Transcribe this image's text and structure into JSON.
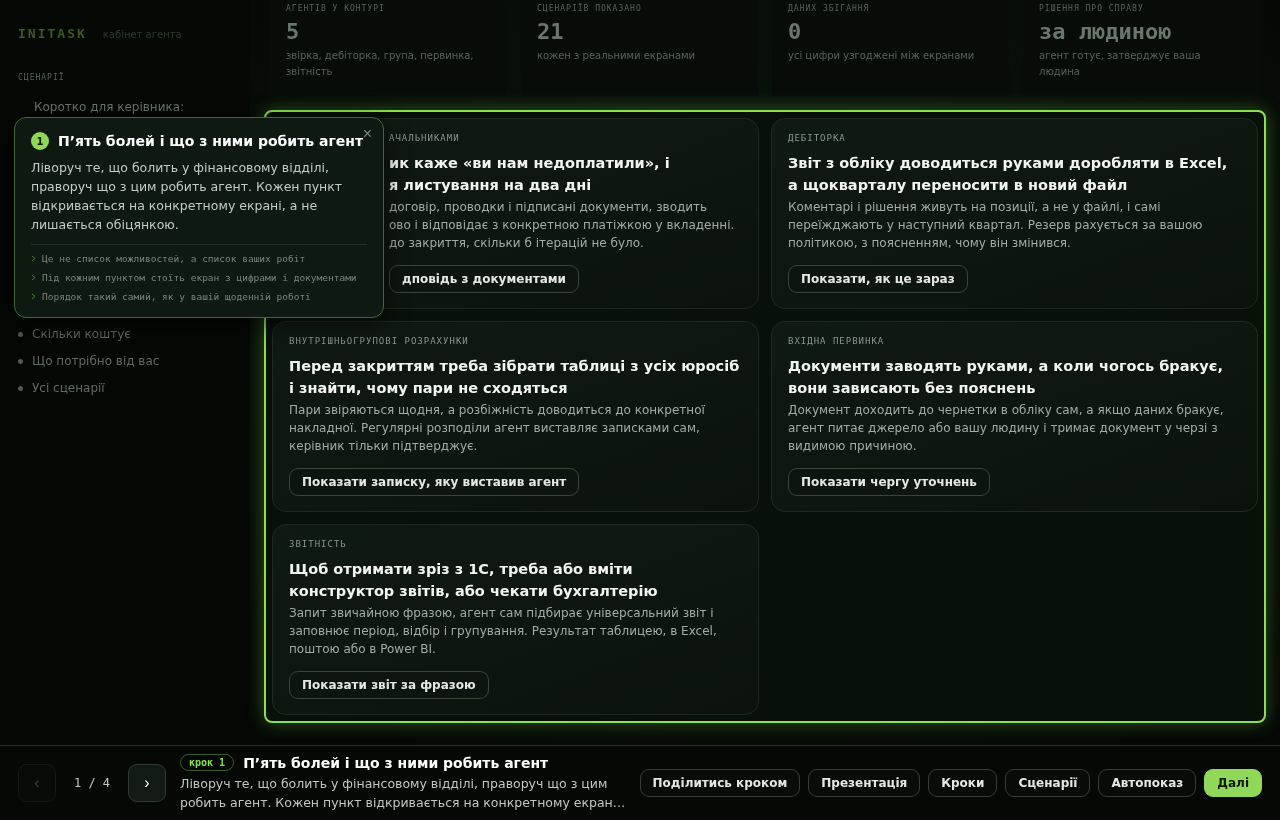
{
  "sidebar": {
    "brand": "INITASK",
    "subtitle": "кабінет агента",
    "section": "СЦЕНАРІЇ",
    "items": [
      {
        "label": "Коротко для керівника:",
        "bullet": false
      },
      {
        "label": "Скільки коштує",
        "bullet": true
      },
      {
        "label": "Що потрібно від вас",
        "bullet": true
      },
      {
        "label": "Усі сценарії",
        "bullet": true
      }
    ]
  },
  "stats": [
    {
      "label": "АГЕНТІВ У КОНТУРІ",
      "value": "5",
      "note": "звірка, дебіторка, група, первинка, звітність"
    },
    {
      "label": "СЦЕНАРІЇВ ПОКАЗАНО",
      "value": "21",
      "note": "кожен з реальними екранами"
    },
    {
      "label": "ДАНИХ ЗБІГАННЯ",
      "value": "0",
      "note": "усі цифри узгоджені між екранами"
    },
    {
      "label": "РІШЕННЯ ПРО СПРАВУ",
      "value": "за людиною",
      "note": "агент готує, затверджує ваша людина"
    }
  ],
  "cards": [
    {
      "tag": "АЧАЛЬНИКАМИ",
      "title": "ик каже «ви нам недоплатили», і\nя листування на два дні",
      "text": "договір, проводки і підписані документи, зводить\nово і відповідає з конкретною платіжкою у вкладенні.\nдо закриття, скільки б ітерацій не було.",
      "button": "дповідь з документами",
      "covered": true
    },
    {
      "tag": "ДЕБІТОРКА",
      "title": "Звіт з обліку доводиться руками доробляти в Excel, а щокварталу переносити в новий файл",
      "text": "Коментарі і рішення живуть на позиції, а не у файлі, і самі переїжджають у наступний квартал. Резерв рахується за вашою політикою, з поясненням, чому він змінився.",
      "button": "Показати, як це зараз",
      "covered": false
    },
    {
      "tag": "ВНУТРІШНЬОГРУПОВІ РОЗРАХУНКИ",
      "title": "Перед закриттям треба зібрати таблиці з усіх юросіб і знайти, чому пари не сходяться",
      "text": "Пари звіряються щодня, а розбіжність доводиться до конкретної накладної. Регулярні розподіли агент виставляє записками сам, керівник тільки підтверджує.",
      "button": "Показати записку, яку виставив агент",
      "covered": false
    },
    {
      "tag": "ВХІДНА ПЕРВИНКА",
      "title": "Документи заводять руками, а коли чогось бракує, вони зависають без пояснень",
      "text": "Документ доходить до чернетки в обліку сам, а якщо даних бракує, агент питає джерело або вашу людину і тримає документ у черзі з видимою причиною.",
      "button": "Показати чергу уточнень",
      "covered": false
    },
    {
      "tag": "ЗВІТНІСТЬ",
      "title": "Щоб отримати зріз з 1С, треба або вміти конструктор звітів, або чекати бухгалтерію",
      "text": "Запит звичайною фразою, агент сам підбирає універсальний звіт і заповнює період, відбір і групування. Результат таблицею, в Excel, поштою або в Power BI.",
      "button": "Показати звіт за фразою",
      "covered": false
    }
  ],
  "popover": {
    "number": "1",
    "title": "П’ять болей і що з ними робить агент",
    "close": "×",
    "text": "Ліворуч те, що болить у фінансовому відділі, праворуч що з цим робить агент. Кожен пункт відкривається на конкретному екрані, а не лишається обіцянкою.",
    "bullets": [
      "Це не список можливостей, а список ваших робіт",
      "Під кожним пунктом стоїть екран з цифрами і документами",
      "Порядок такий самий, як у вашій щоденній роботі"
    ]
  },
  "footer": {
    "prev": {
      "label": "‹",
      "disabled": true
    },
    "counter": "1 / 4",
    "next": {
      "label": "›",
      "disabled": false
    },
    "step": "крок 1",
    "title": "П’ять болей і що з ними робить агент",
    "text": "Ліворуч те, що болить у фінансовому відділі, праворуч що з цим робить агент. Кожен пункт відкривається на конкретному екран…",
    "buttons": [
      {
        "label": "Поділитись кроком",
        "kind": "secondary"
      },
      {
        "label": "Презентація",
        "kind": "secondary"
      },
      {
        "label": "Кроки",
        "kind": "secondary"
      },
      {
        "label": "Сценарії",
        "kind": "secondary"
      },
      {
        "label": "Автопоказ",
        "kind": "secondary"
      },
      {
        "label": "Далі",
        "kind": "primary"
      }
    ]
  }
}
